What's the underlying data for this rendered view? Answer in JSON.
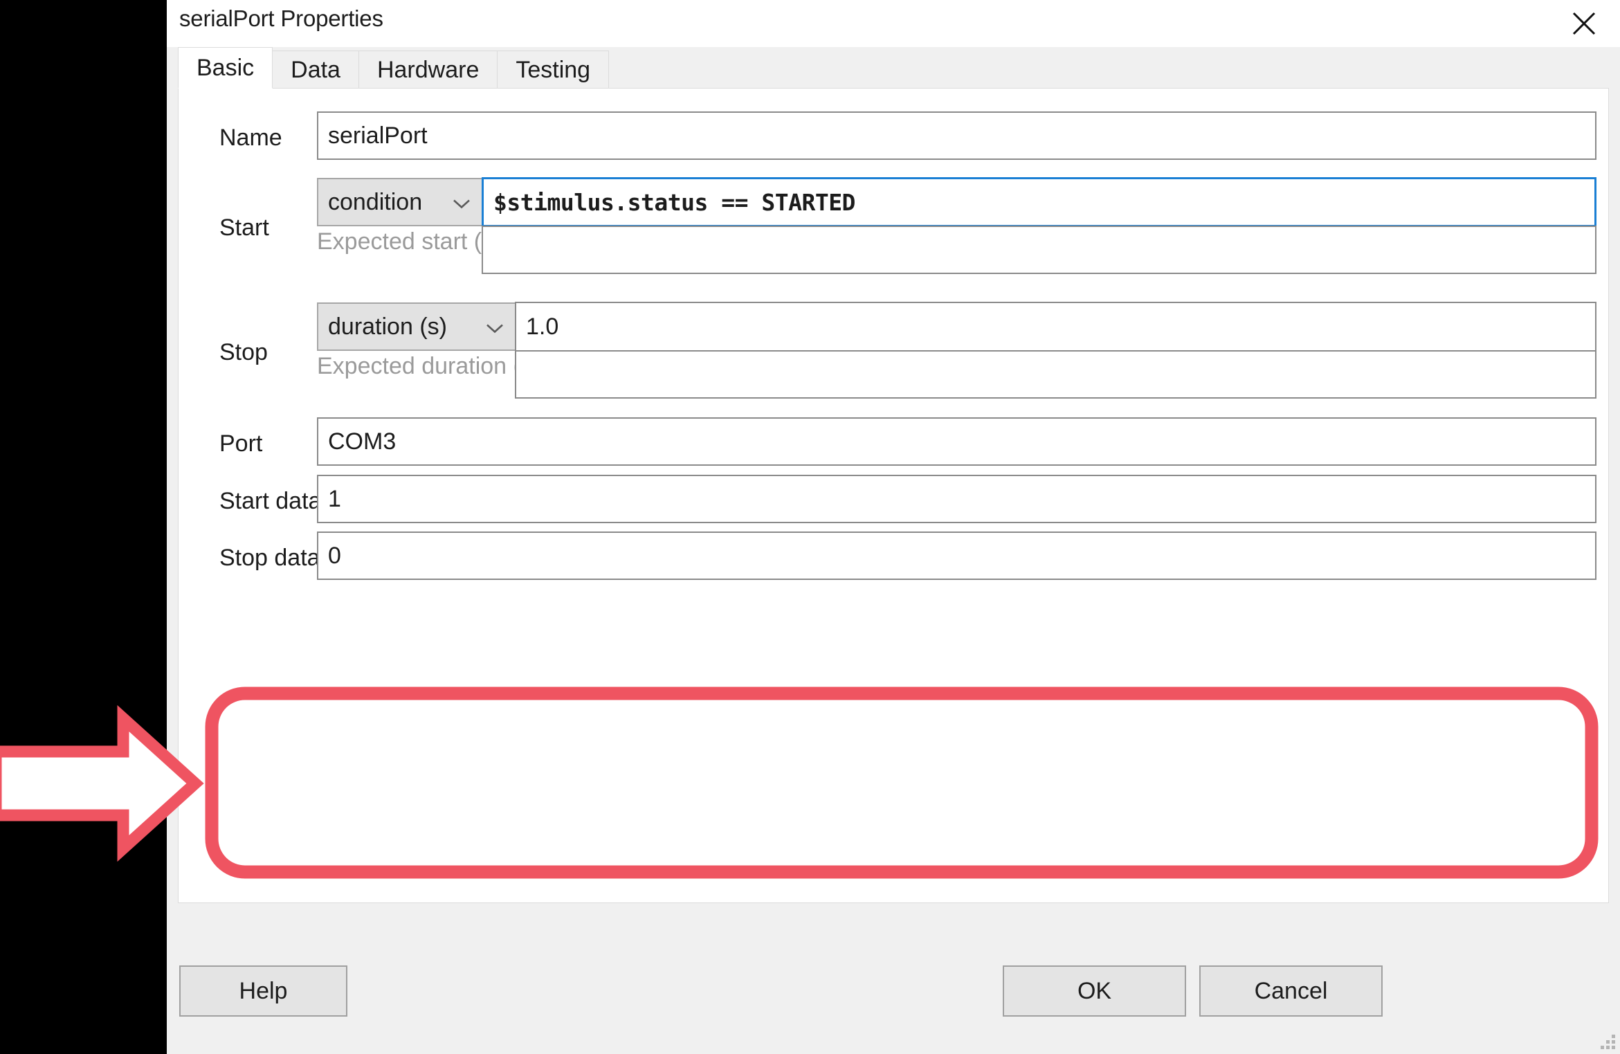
{
  "window": {
    "title": "serialPort Properties",
    "close_icon": "close-icon"
  },
  "tabs": [
    {
      "label": "Basic",
      "active": true
    },
    {
      "label": "Data",
      "active": false
    },
    {
      "label": "Hardware",
      "active": false
    },
    {
      "label": "Testing",
      "active": false
    }
  ],
  "form": {
    "name": {
      "label": "Name",
      "value": "serialPort"
    },
    "start": {
      "label": "Start",
      "mode_value": "condition",
      "condition_value": "$stimulus.status == STARTED",
      "expected_label": "Expected start (s)",
      "expected_value": ""
    },
    "stop": {
      "label": "Stop",
      "mode_value": "duration (s)",
      "duration_value": "1.0",
      "expected_label": "Expected duration (s)",
      "expected_value": ""
    },
    "port": {
      "label": "Port",
      "value": "COM3"
    },
    "start_data": {
      "label": "Start data",
      "value": "1"
    },
    "stop_data": {
      "label": "Stop data",
      "value": "0"
    }
  },
  "buttons": {
    "help": "Help",
    "ok": "OK",
    "cancel": "Cancel"
  },
  "annotation": {
    "highlight_color": "#ef5461",
    "arrow_icon": "right-arrow-icon",
    "highlight_icon": "rounded-rect-highlight"
  },
  "colors": {
    "focus_border": "#1a7fd4",
    "dialog_bg": "#f0f0f0",
    "panel_bg": "#ffffff",
    "field_border": "#8a8a8a",
    "combo_bg": "#e2e2e2"
  }
}
